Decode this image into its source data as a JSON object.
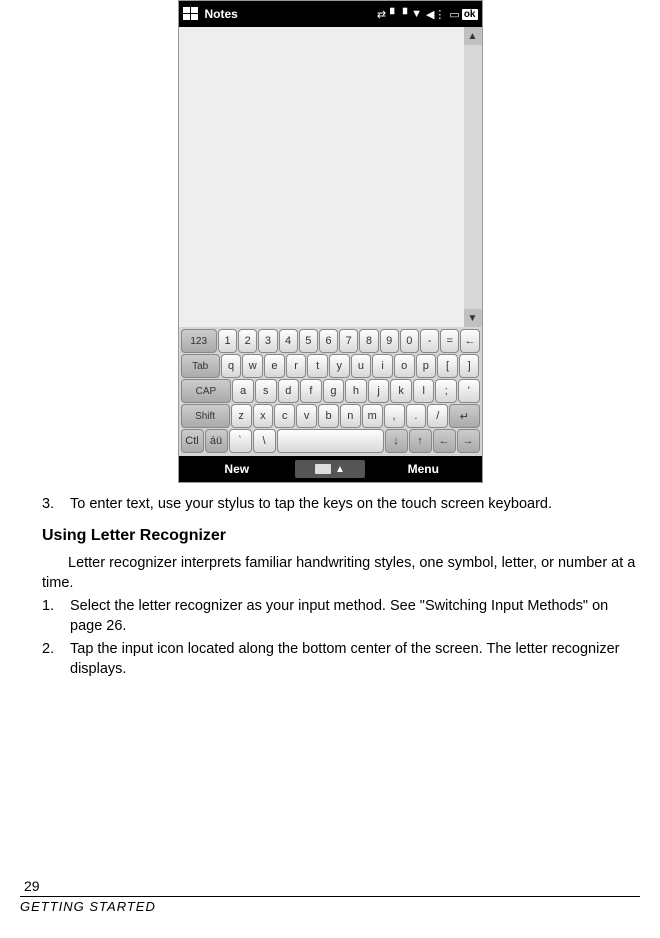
{
  "status_bar": {
    "app_title": "Notes",
    "ok_label": "ok"
  },
  "bottom_bar": {
    "left": "New",
    "right": "Menu"
  },
  "keyboard": {
    "row1": [
      "123",
      "1",
      "2",
      "3",
      "4",
      "5",
      "6",
      "7",
      "8",
      "9",
      "0",
      "-",
      "=",
      "←"
    ],
    "row2": [
      "Tab",
      "q",
      "w",
      "e",
      "r",
      "t",
      "y",
      "u",
      "i",
      "o",
      "p",
      "[",
      "]"
    ],
    "row3": [
      "CAP",
      "a",
      "s",
      "d",
      "f",
      "g",
      "h",
      "j",
      "k",
      "l",
      ";",
      "'"
    ],
    "row4": [
      "Shift",
      "z",
      "x",
      "c",
      "v",
      "b",
      "n",
      "m",
      ",",
      ".",
      "/",
      "↵"
    ],
    "row5": [
      "Ctl",
      "áü",
      "`",
      "\\",
      " ",
      "↓",
      "↑",
      "←",
      "→"
    ]
  },
  "text": {
    "step3_num": "3.",
    "step3": "To enter text, use your stylus to tap the keys on the touch screen keyboard.",
    "heading": "Using Letter Recognizer",
    "intro": "Letter recognizer interprets familiar handwriting styles, one symbol, letter, or number at a time.",
    "step1_num": "1.",
    "step1": "Select the letter recognizer as your input method. See \"Switching Input Methods\" on page 26.",
    "step2_num": "2.",
    "step2": "Tap the input icon located along the bottom center of the screen. The letter recognizer displays."
  },
  "footer": {
    "page_number": "29",
    "chapter": "Getting Started"
  }
}
